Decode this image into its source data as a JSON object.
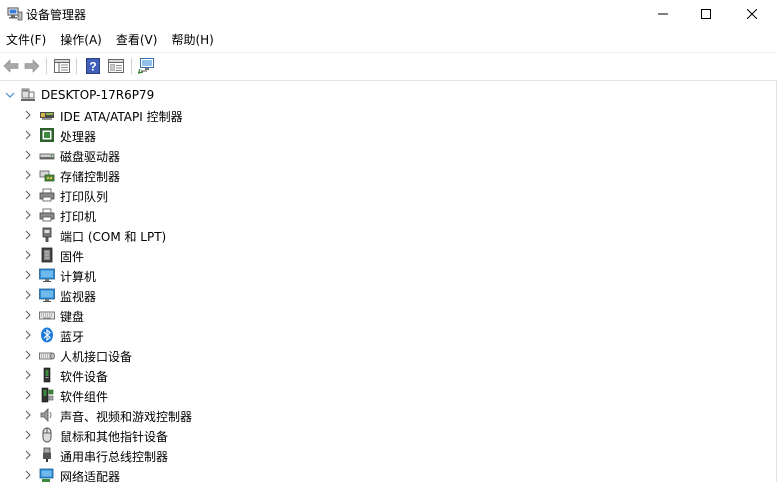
{
  "window": {
    "title": "设备管理器",
    "icon": "device-manager-icon",
    "controls": {
      "minimize": "—",
      "maximize": "☐",
      "close": "✕"
    }
  },
  "menubar": {
    "items": [
      {
        "label": "文件(F)"
      },
      {
        "label": "操作(A)"
      },
      {
        "label": "查看(V)"
      },
      {
        "label": "帮助(H)"
      }
    ]
  },
  "toolbar": {
    "buttons": [
      "back-icon",
      "forward-icon",
      "properties-icon",
      "help-icon",
      "show-hide-console-tree-icon",
      "scan-hardware-icon"
    ]
  },
  "tree": {
    "root": {
      "label": "DESKTOP-17R6P79",
      "icon": "computer-tree-root-icon",
      "expanded": true
    },
    "nodes": [
      {
        "label": "IDE ATA/ATAPI 控制器",
        "icon": "ide-controller-icon"
      },
      {
        "label": "处理器",
        "icon": "processor-icon"
      },
      {
        "label": "磁盘驱动器",
        "icon": "disk-drive-icon"
      },
      {
        "label": "存储控制器",
        "icon": "storage-controller-icon"
      },
      {
        "label": "打印队列",
        "icon": "print-queue-icon"
      },
      {
        "label": "打印机",
        "icon": "printer-icon"
      },
      {
        "label": "端口 (COM 和 LPT)",
        "icon": "port-icon"
      },
      {
        "label": "固件",
        "icon": "firmware-icon"
      },
      {
        "label": "计算机",
        "icon": "computer-icon"
      },
      {
        "label": "监视器",
        "icon": "monitor-icon"
      },
      {
        "label": "键盘",
        "icon": "keyboard-icon"
      },
      {
        "label": "蓝牙",
        "icon": "bluetooth-icon"
      },
      {
        "label": "人机接口设备",
        "icon": "hid-icon"
      },
      {
        "label": "软件设备",
        "icon": "software-device-icon"
      },
      {
        "label": "软件组件",
        "icon": "software-component-icon"
      },
      {
        "label": "声音、视频和游戏控制器",
        "icon": "sound-icon"
      },
      {
        "label": "鼠标和其他指针设备",
        "icon": "mouse-icon"
      },
      {
        "label": "通用串行总线控制器",
        "icon": "usb-icon"
      },
      {
        "label": "网络适配器",
        "icon": "network-adapter-icon"
      }
    ]
  },
  "colors": {
    "bluetooth": "#1e7bd8",
    "monitor": "#2a8ad6",
    "chevron": "#5a5a5a"
  }
}
